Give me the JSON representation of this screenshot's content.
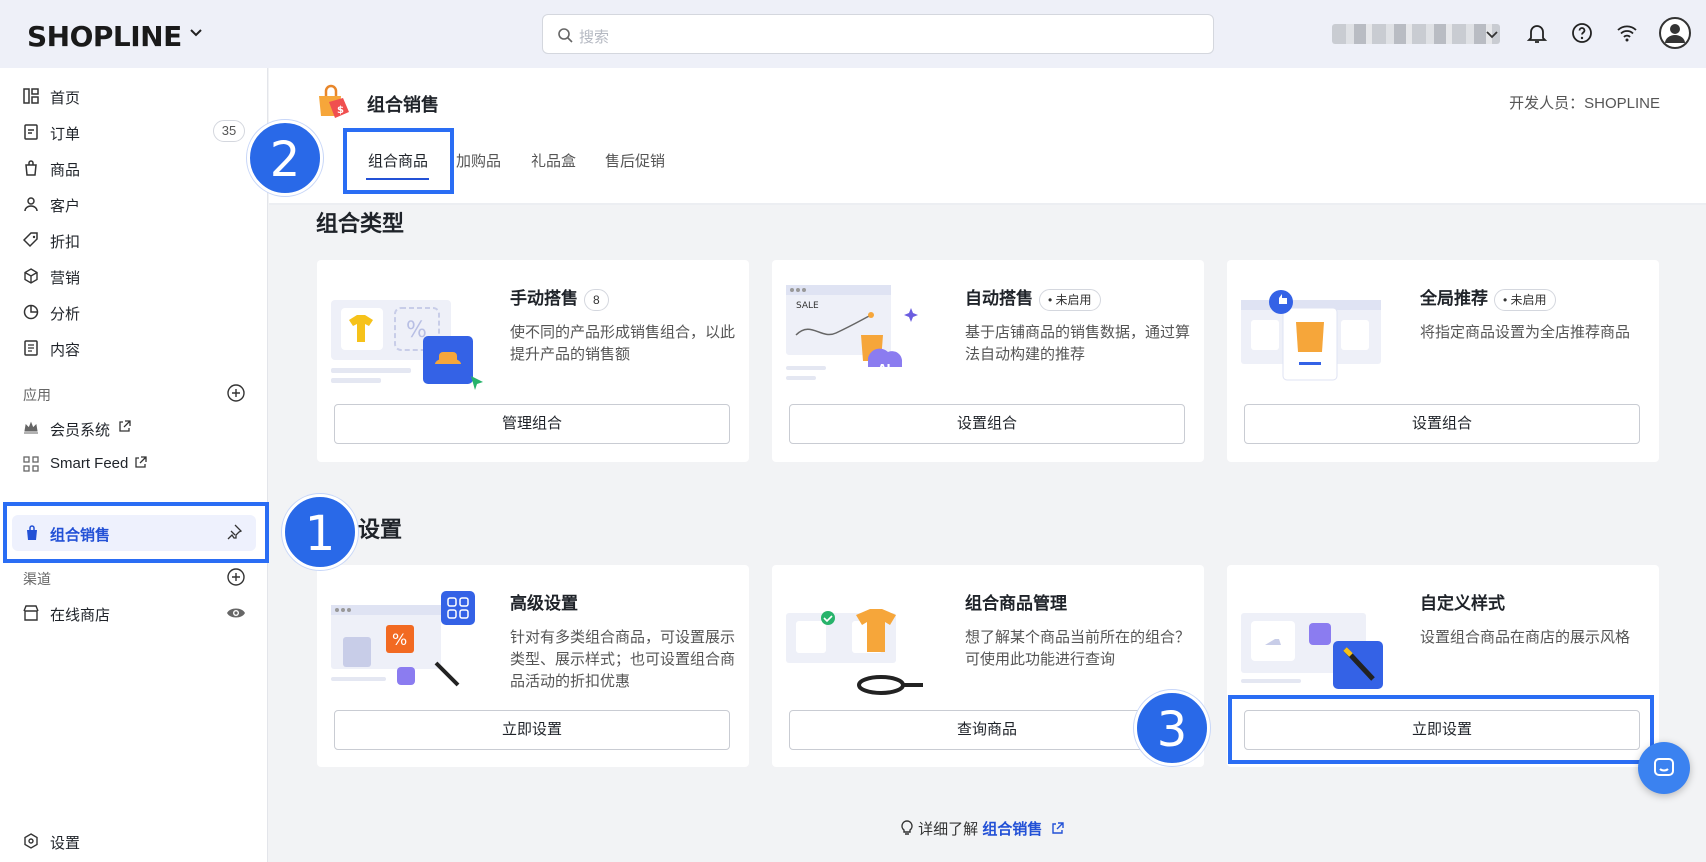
{
  "topbar": {
    "logo": "SHOPLINE",
    "search_placeholder": "搜索"
  },
  "sidebar": {
    "items": [
      {
        "label": "首页",
        "icon": "dashboard-icon"
      },
      {
        "label": "订单",
        "icon": "order-icon",
        "badge": "35"
      },
      {
        "label": "商品",
        "icon": "bag-icon"
      },
      {
        "label": "客户",
        "icon": "user-icon"
      },
      {
        "label": "折扣",
        "icon": "tag-icon"
      },
      {
        "label": "营销",
        "icon": "cube-icon"
      },
      {
        "label": "分析",
        "icon": "pie-icon"
      },
      {
        "label": "内容",
        "icon": "doc-icon"
      }
    ],
    "apps_section": "应用",
    "apps": [
      {
        "label": "会员系统",
        "icon": "crown-icon"
      },
      {
        "label": "Smart Feed",
        "icon": "grid-icon"
      }
    ],
    "active": {
      "label": "组合销售",
      "icon": "bundle-icon"
    },
    "channels_section": "渠道",
    "channels": [
      {
        "label": "在线商店",
        "icon": "store-icon"
      }
    ],
    "settings": "设置"
  },
  "header": {
    "title": "组合销售",
    "developer": "开发人员：SHOPLINE",
    "tabs": [
      "组合商品",
      "加购品",
      "礼品盒",
      "售后促销"
    ]
  },
  "sections": {
    "types": "组合类型",
    "settings": "设置"
  },
  "type_cards": [
    {
      "title": "手动搭售",
      "badge": "8",
      "desc": "使不同的产品形成销售组合，以此提升产品的销售额",
      "button": "管理组合"
    },
    {
      "title": "自动搭售",
      "badge": "• 未启用",
      "desc": "基于店铺商品的销售数据，通过算法自动构建的推荐",
      "button": "设置组合"
    },
    {
      "title": "全局推荐",
      "badge": "• 未启用",
      "desc": "将指定商品设置为全店推荐商品",
      "button": "设置组合"
    }
  ],
  "setting_cards": [
    {
      "title": "高级设置",
      "desc": "针对有多类组合商品，可设置展示类型、展示样式；也可设置组合商品活动的折扣优惠",
      "button": "立即设置"
    },
    {
      "title": "组合商品管理",
      "desc": "想了解某个商品当前所在的组合？可使用此功能进行查询",
      "button": "查询商品"
    },
    {
      "title": "自定义样式",
      "desc": "设置组合商品在商店的展示风格",
      "button": "立即设置"
    }
  ],
  "footer": {
    "prefix": "详细了解",
    "link": "组合销售"
  },
  "steps": [
    "1",
    "2",
    "3"
  ],
  "colors": {
    "accent": "#2351d6",
    "highlight": "#2a6df4",
    "step": "#2969e8"
  }
}
